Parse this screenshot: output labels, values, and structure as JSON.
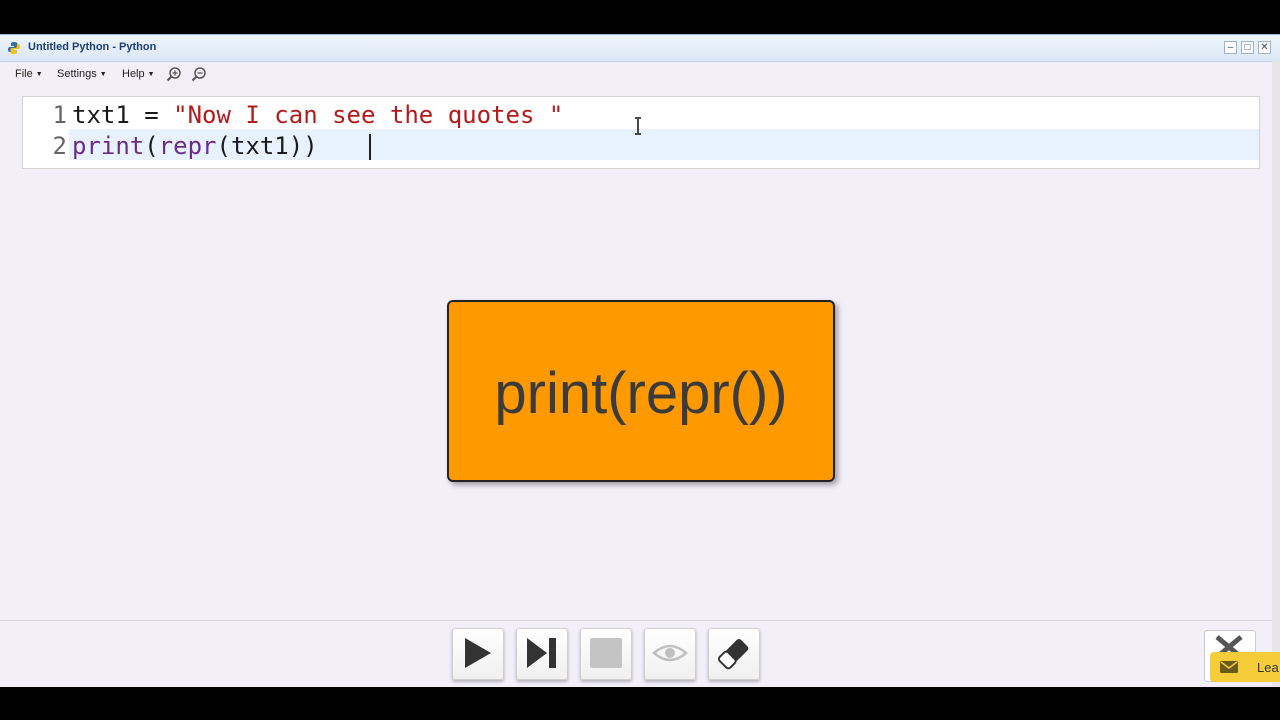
{
  "window": {
    "title": "Untitled Python - Python",
    "controls": [
      "minimize",
      "maximize",
      "close"
    ]
  },
  "menubar": {
    "file": "File",
    "settings": "Settings",
    "help": "Help",
    "zoom_in_icon": "zoom-in-icon",
    "zoom_out_icon": "zoom-out-icon"
  },
  "editor": {
    "lines": [
      {
        "number": "1",
        "code": "txt1 = \"Now I can see the quotes \""
      },
      {
        "number": "2",
        "code": "print(repr(txt1))"
      }
    ],
    "line1": {
      "var": "txt1",
      "op": " = ",
      "str": "\"Now I can see the quotes \""
    },
    "line2": {
      "fn": "print",
      "rest_open": "(",
      "fn2": "repr",
      "rest": "(txt1))"
    }
  },
  "overlay_card": {
    "text": "print(repr())",
    "color": "#ff9900"
  },
  "toolbar": {
    "buttons": [
      "run-button",
      "step-button",
      "stop-button",
      "view-button",
      "clear-button"
    ]
  },
  "notice": {
    "label": "Lea"
  }
}
